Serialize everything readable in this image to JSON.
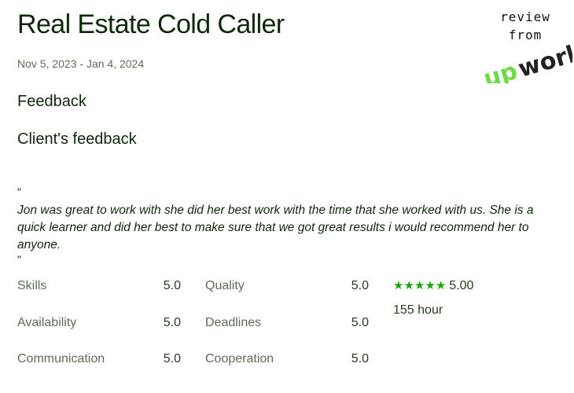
{
  "header": {
    "title": "Real Estate Cold Caller",
    "dates": "Nov 5, 2023 - Jan 4, 2024"
  },
  "feedback": {
    "heading": "Feedback",
    "client_heading": "Client's feedback",
    "quote_open": "\"",
    "quote_close": "\"",
    "text": "Jon was great to work with she did her best work with the time that she worked with us. She is a quick learner and did her best to make sure that we got great results i would recommend her to anyone."
  },
  "metrics": {
    "left": [
      {
        "label": "Skills",
        "value": "5.0"
      },
      {
        "label": "Availability",
        "value": "5.0"
      },
      {
        "label": "Communication",
        "value": "5.0"
      }
    ],
    "right": [
      {
        "label": "Quality",
        "value": "5.0"
      },
      {
        "label": "Deadlines",
        "value": "5.0"
      },
      {
        "label": "Cooperation",
        "value": "5.0"
      }
    ]
  },
  "summary": {
    "stars": 5,
    "overall_score": "5.00",
    "hours": "155 hour",
    "star_color": "#14a800"
  },
  "badge": {
    "line1": "review",
    "line2": "from",
    "logo_text": "upwork",
    "logo_color": "#6fda44"
  }
}
